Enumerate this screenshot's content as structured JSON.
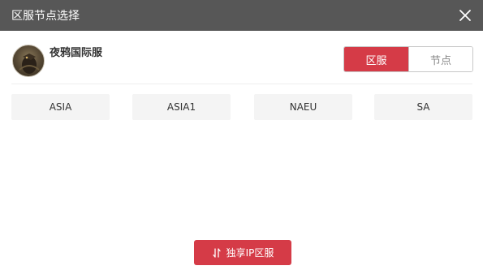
{
  "window": {
    "title": "区服节点选择"
  },
  "game": {
    "name": "夜鸦国际服"
  },
  "toggle": {
    "region_label": "区服",
    "node_label": "节点",
    "selected": "区服"
  },
  "regions": [
    {
      "label": "ASIA"
    },
    {
      "label": "ASIA1"
    },
    {
      "label": "NAEU"
    },
    {
      "label": "SA"
    }
  ],
  "footer": {
    "exclusive_button_label": "独享IP区服",
    "exclusive_button_icon": "swap-icon"
  },
  "colors": {
    "accent": "#d53b47",
    "titlebar": "#575757",
    "tile": "#f4f4f4"
  }
}
